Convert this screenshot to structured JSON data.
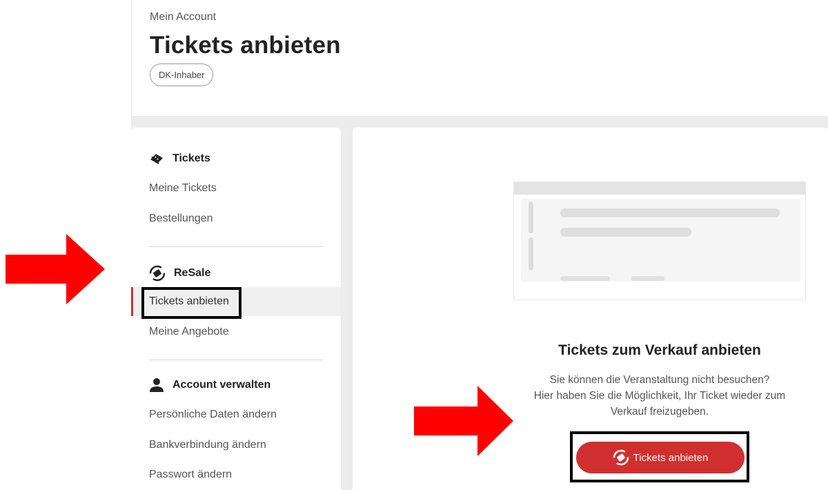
{
  "header": {
    "breadcrumb": "Mein Account",
    "title": "Tickets anbieten",
    "badge": "DK-Inhaber"
  },
  "sidebar": {
    "sections": [
      {
        "title": "Tickets",
        "icon": "ticket-icon",
        "items": [
          {
            "label": "Meine Tickets",
            "active": false
          },
          {
            "label": "Bestellungen",
            "active": false
          }
        ]
      },
      {
        "title": "ReSale",
        "icon": "resale-icon",
        "items": [
          {
            "label": "Tickets anbieten",
            "active": true
          },
          {
            "label": "Meine Angebote",
            "active": false
          }
        ]
      },
      {
        "title": "Account verwalten",
        "icon": "user-icon",
        "items": [
          {
            "label": "Persönliche Daten ändern",
            "active": false
          },
          {
            "label": "Bankverbindung ändern",
            "active": false
          },
          {
            "label": "Passwort ändern",
            "active": false
          }
        ]
      }
    ]
  },
  "main": {
    "heading": "Tickets zum Verkauf anbieten",
    "text_line1": "Sie können die Veranstaltung nicht besuchen?",
    "text_line2": "Hier haben Sie die Möglichkeit, Ihr Ticket wieder zum",
    "text_line3": "Verkauf freizugeben.",
    "button_label": "Tickets anbieten",
    "button_icon": "resale-icon"
  },
  "colors": {
    "accent": "#d12f2f",
    "active_bar": "#d62d2d",
    "band": "#ececec",
    "annotation_arrow": "#ff0000",
    "annotation_box": "#000000"
  }
}
